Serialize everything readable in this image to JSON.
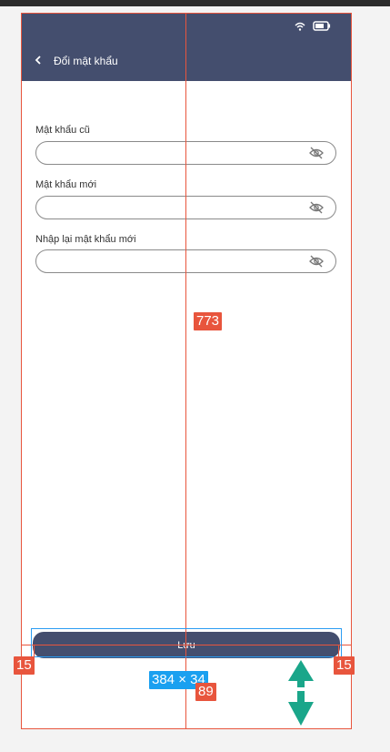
{
  "app": {
    "title": "Đổi mật khẩu",
    "back_icon": "chevron-left-icon",
    "status_icons": [
      "wifi-icon",
      "battery-icon"
    ]
  },
  "form": {
    "fields": [
      {
        "label": "Mật khẩu cũ",
        "value": "",
        "icon": "eye-off-icon"
      },
      {
        "label": "Mật khẩu mới",
        "value": "",
        "icon": "eye-off-icon"
      },
      {
        "label": "Nhập lại mật khẩu mới",
        "value": "",
        "icon": "eye-off-icon"
      }
    ],
    "save_label": "Lưu"
  },
  "measurements": {
    "height_label": "773",
    "left_margin": "15",
    "right_margin": "15",
    "button_size": "384 × 34",
    "bottom_offset": "89"
  },
  "colors": {
    "app_bar": "#444e6e",
    "guide": "#e8553d",
    "size_badge": "#1aa0f0",
    "arrow": "#1aa68a"
  }
}
